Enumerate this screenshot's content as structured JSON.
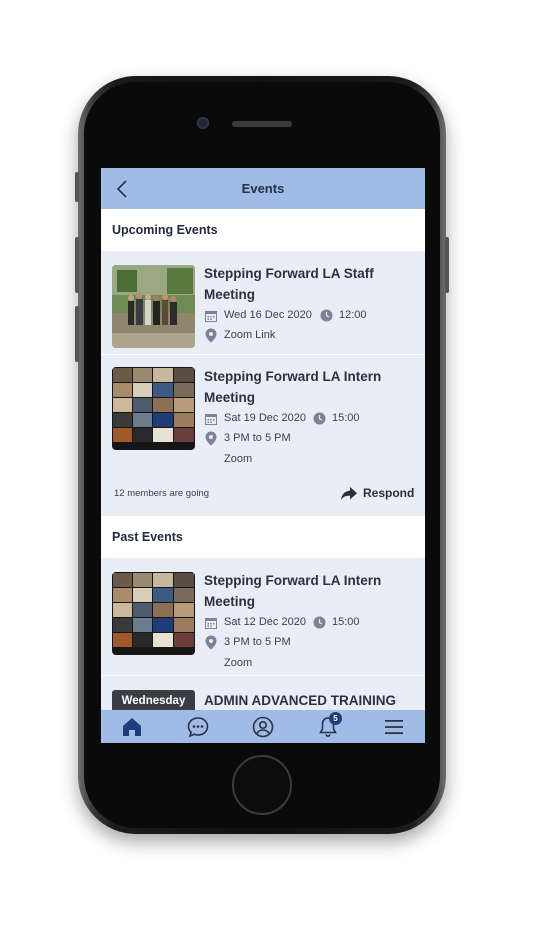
{
  "header": {
    "title": "Events",
    "back_icon": "chevron-left-icon"
  },
  "upcoming": {
    "heading": "Upcoming Events",
    "events": [
      {
        "title": "Stepping Forward LA Staff Meeting",
        "date": "Wed 16 Dec 2020",
        "time": "12:00",
        "location": "Zoom Link",
        "location_note": "",
        "thumb": "group-photo"
      },
      {
        "title": "Stepping Forward LA Intern Meeting",
        "date": "Sat 19 Dec 2020",
        "time": "15:00",
        "location": "3 PM to 5 PM",
        "location_note": "Zoom",
        "thumb": "video-grid"
      }
    ],
    "going_text": "12 members are going",
    "respond_label": "Respond"
  },
  "past": {
    "heading": "Past Events",
    "events": [
      {
        "title": "Stepping Forward LA Intern Meeting",
        "date": "Sat 12 Dec 2020",
        "time": "15:00",
        "location": "3 PM to 5 PM",
        "location_note": "Zoom",
        "thumb": "video-grid"
      },
      {
        "title": "ADMIN ADVANCED TRAINING",
        "day_badge": "Wednesday"
      }
    ]
  },
  "tabbar": {
    "items": [
      "home-icon",
      "chat-icon",
      "profile-icon",
      "bell-icon",
      "menu-icon"
    ],
    "notification_count": "5"
  },
  "colors": {
    "header_bg": "#9fbbe6",
    "card_bg": "#e8edf6",
    "accent": "#1e3d7a"
  }
}
